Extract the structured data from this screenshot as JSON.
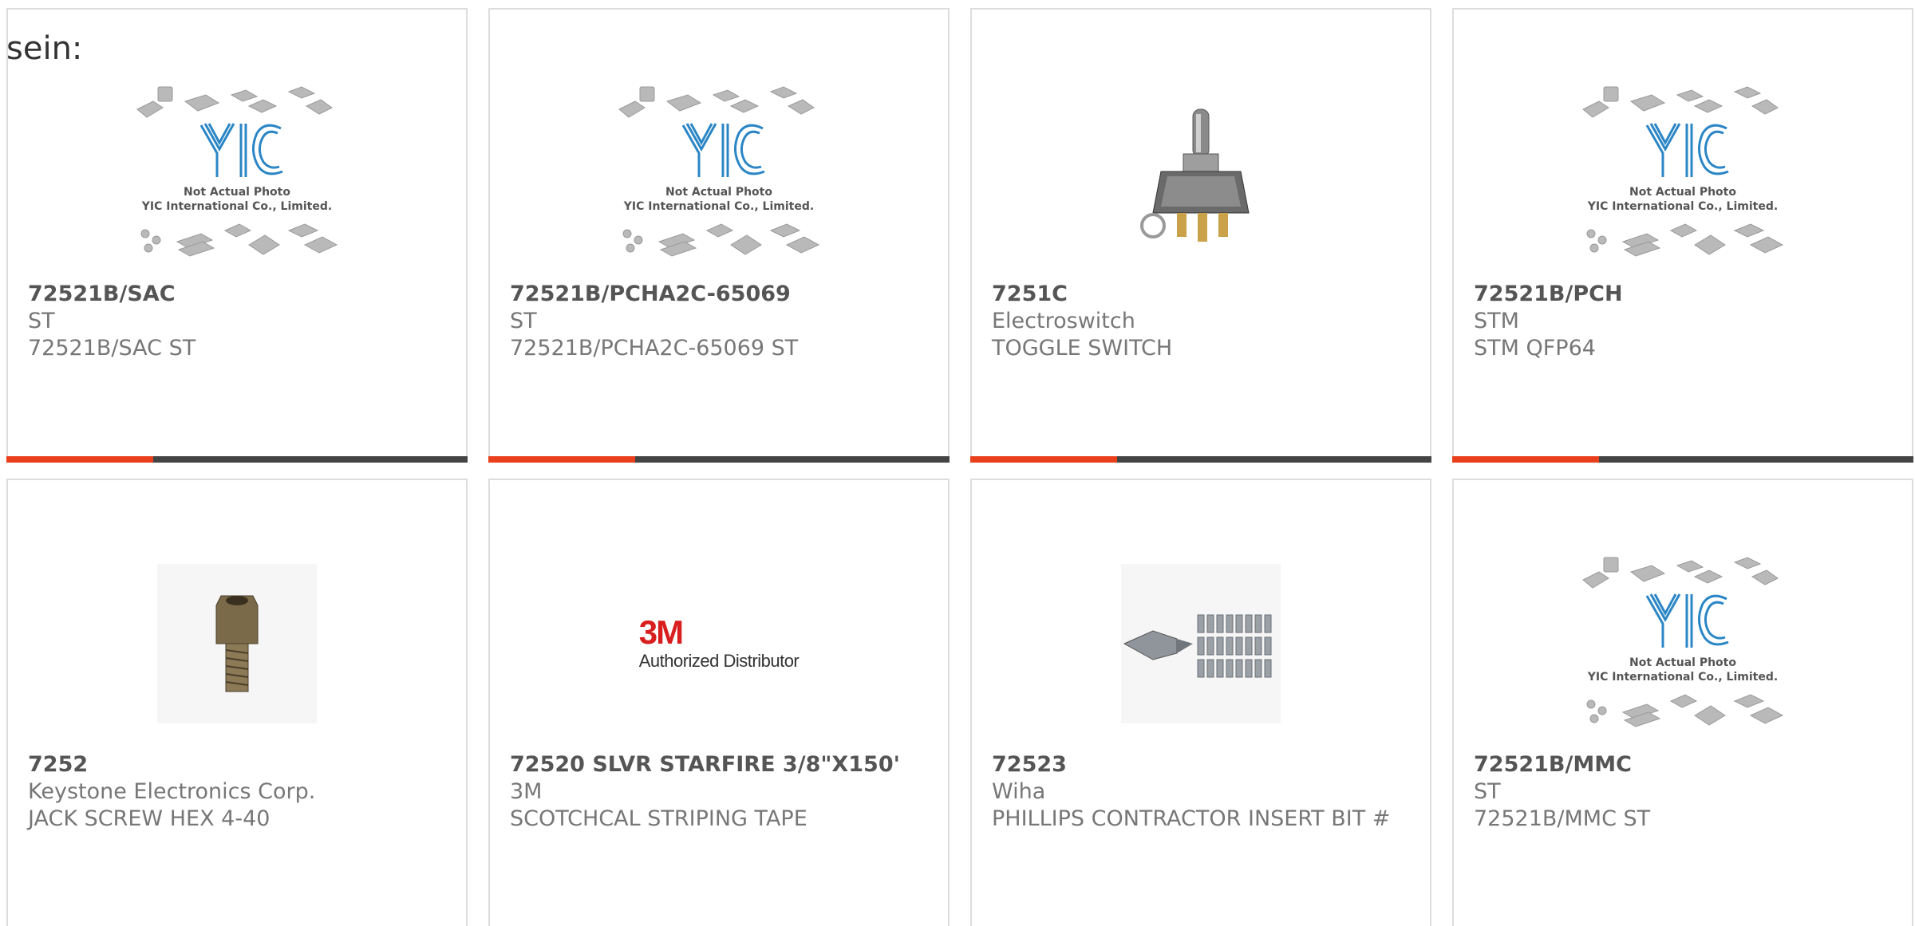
{
  "top_fragment": "sein:",
  "placeholder": {
    "line1": "Not Actual Photo",
    "line2": "YIC International Co., Limited.",
    "logo_text": "YIC"
  },
  "logo_3m": {
    "brand": "3M",
    "tagline": "Authorized Distributor"
  },
  "colors": {
    "accent_bar": "#e8401c",
    "dark_bar": "#444444",
    "yic_blue": "#2b86c5"
  },
  "products": [
    {
      "part": "72521B/SAC",
      "manufacturer": "ST",
      "description": "72521B/SAC ST",
      "image": "yic-placeholder"
    },
    {
      "part": "72521B/PCHA2C-65069",
      "manufacturer": "ST",
      "description": "72521B/PCHA2C-65069 ST",
      "image": "yic-placeholder"
    },
    {
      "part": "7251C",
      "manufacturer": "Electroswitch",
      "description": "TOGGLE SWITCH",
      "image": "toggle-switch"
    },
    {
      "part": "72521B/PCH",
      "manufacturer": "STM",
      "description": "STM QFP64",
      "image": "yic-placeholder"
    },
    {
      "part": "7252",
      "manufacturer": "Keystone Electronics Corp.",
      "description": "JACK SCREW HEX 4-40",
      "image": "jack-screw"
    },
    {
      "part": "72520 SLVR STARFIRE 3/8\"X150'",
      "manufacturer": "3M",
      "description": "SCOTCHCAL STRIPING TAPE",
      "image": "3m-logo"
    },
    {
      "part": "72523",
      "manufacturer": "Wiha",
      "description": "PHILLIPS CONTRACTOR INSERT BIT #",
      "image": "insert-bits"
    },
    {
      "part": "72521B/MMC",
      "manufacturer": "ST",
      "description": "72521B/MMC ST",
      "image": "yic-placeholder"
    }
  ]
}
